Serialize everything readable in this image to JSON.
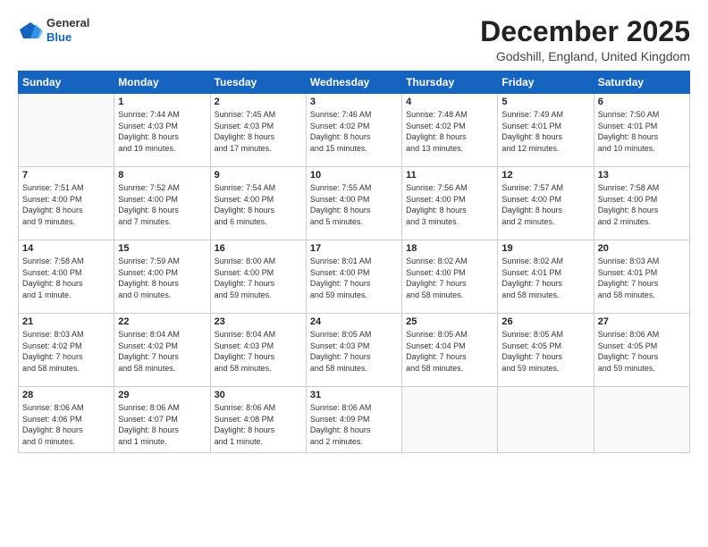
{
  "header": {
    "logo_line1": "General",
    "logo_line2": "Blue",
    "month_title": "December 2025",
    "location": "Godshill, England, United Kingdom"
  },
  "weekdays": [
    "Sunday",
    "Monday",
    "Tuesday",
    "Wednesday",
    "Thursday",
    "Friday",
    "Saturday"
  ],
  "weeks": [
    [
      {
        "day": "",
        "info": ""
      },
      {
        "day": "1",
        "info": "Sunrise: 7:44 AM\nSunset: 4:03 PM\nDaylight: 8 hours\nand 19 minutes."
      },
      {
        "day": "2",
        "info": "Sunrise: 7:45 AM\nSunset: 4:03 PM\nDaylight: 8 hours\nand 17 minutes."
      },
      {
        "day": "3",
        "info": "Sunrise: 7:46 AM\nSunset: 4:02 PM\nDaylight: 8 hours\nand 15 minutes."
      },
      {
        "day": "4",
        "info": "Sunrise: 7:48 AM\nSunset: 4:02 PM\nDaylight: 8 hours\nand 13 minutes."
      },
      {
        "day": "5",
        "info": "Sunrise: 7:49 AM\nSunset: 4:01 PM\nDaylight: 8 hours\nand 12 minutes."
      },
      {
        "day": "6",
        "info": "Sunrise: 7:50 AM\nSunset: 4:01 PM\nDaylight: 8 hours\nand 10 minutes."
      }
    ],
    [
      {
        "day": "7",
        "info": "Sunrise: 7:51 AM\nSunset: 4:00 PM\nDaylight: 8 hours\nand 9 minutes."
      },
      {
        "day": "8",
        "info": "Sunrise: 7:52 AM\nSunset: 4:00 PM\nDaylight: 8 hours\nand 7 minutes."
      },
      {
        "day": "9",
        "info": "Sunrise: 7:54 AM\nSunset: 4:00 PM\nDaylight: 8 hours\nand 6 minutes."
      },
      {
        "day": "10",
        "info": "Sunrise: 7:55 AM\nSunset: 4:00 PM\nDaylight: 8 hours\nand 5 minutes."
      },
      {
        "day": "11",
        "info": "Sunrise: 7:56 AM\nSunset: 4:00 PM\nDaylight: 8 hours\nand 3 minutes."
      },
      {
        "day": "12",
        "info": "Sunrise: 7:57 AM\nSunset: 4:00 PM\nDaylight: 8 hours\nand 2 minutes."
      },
      {
        "day": "13",
        "info": "Sunrise: 7:58 AM\nSunset: 4:00 PM\nDaylight: 8 hours\nand 2 minutes."
      }
    ],
    [
      {
        "day": "14",
        "info": "Sunrise: 7:58 AM\nSunset: 4:00 PM\nDaylight: 8 hours\nand 1 minute."
      },
      {
        "day": "15",
        "info": "Sunrise: 7:59 AM\nSunset: 4:00 PM\nDaylight: 8 hours\nand 0 minutes."
      },
      {
        "day": "16",
        "info": "Sunrise: 8:00 AM\nSunset: 4:00 PM\nDaylight: 7 hours\nand 59 minutes."
      },
      {
        "day": "17",
        "info": "Sunrise: 8:01 AM\nSunset: 4:00 PM\nDaylight: 7 hours\nand 59 minutes."
      },
      {
        "day": "18",
        "info": "Sunrise: 8:02 AM\nSunset: 4:00 PM\nDaylight: 7 hours\nand 58 minutes."
      },
      {
        "day": "19",
        "info": "Sunrise: 8:02 AM\nSunset: 4:01 PM\nDaylight: 7 hours\nand 58 minutes."
      },
      {
        "day": "20",
        "info": "Sunrise: 8:03 AM\nSunset: 4:01 PM\nDaylight: 7 hours\nand 58 minutes."
      }
    ],
    [
      {
        "day": "21",
        "info": "Sunrise: 8:03 AM\nSunset: 4:02 PM\nDaylight: 7 hours\nand 58 minutes."
      },
      {
        "day": "22",
        "info": "Sunrise: 8:04 AM\nSunset: 4:02 PM\nDaylight: 7 hours\nand 58 minutes."
      },
      {
        "day": "23",
        "info": "Sunrise: 8:04 AM\nSunset: 4:03 PM\nDaylight: 7 hours\nand 58 minutes."
      },
      {
        "day": "24",
        "info": "Sunrise: 8:05 AM\nSunset: 4:03 PM\nDaylight: 7 hours\nand 58 minutes."
      },
      {
        "day": "25",
        "info": "Sunrise: 8:05 AM\nSunset: 4:04 PM\nDaylight: 7 hours\nand 58 minutes."
      },
      {
        "day": "26",
        "info": "Sunrise: 8:05 AM\nSunset: 4:05 PM\nDaylight: 7 hours\nand 59 minutes."
      },
      {
        "day": "27",
        "info": "Sunrise: 8:06 AM\nSunset: 4:05 PM\nDaylight: 7 hours\nand 59 minutes."
      }
    ],
    [
      {
        "day": "28",
        "info": "Sunrise: 8:06 AM\nSunset: 4:06 PM\nDaylight: 8 hours\nand 0 minutes."
      },
      {
        "day": "29",
        "info": "Sunrise: 8:06 AM\nSunset: 4:07 PM\nDaylight: 8 hours\nand 1 minute."
      },
      {
        "day": "30",
        "info": "Sunrise: 8:06 AM\nSunset: 4:08 PM\nDaylight: 8 hours\nand 1 minute."
      },
      {
        "day": "31",
        "info": "Sunrise: 8:06 AM\nSunset: 4:09 PM\nDaylight: 8 hours\nand 2 minutes."
      },
      {
        "day": "",
        "info": ""
      },
      {
        "day": "",
        "info": ""
      },
      {
        "day": "",
        "info": ""
      }
    ]
  ]
}
